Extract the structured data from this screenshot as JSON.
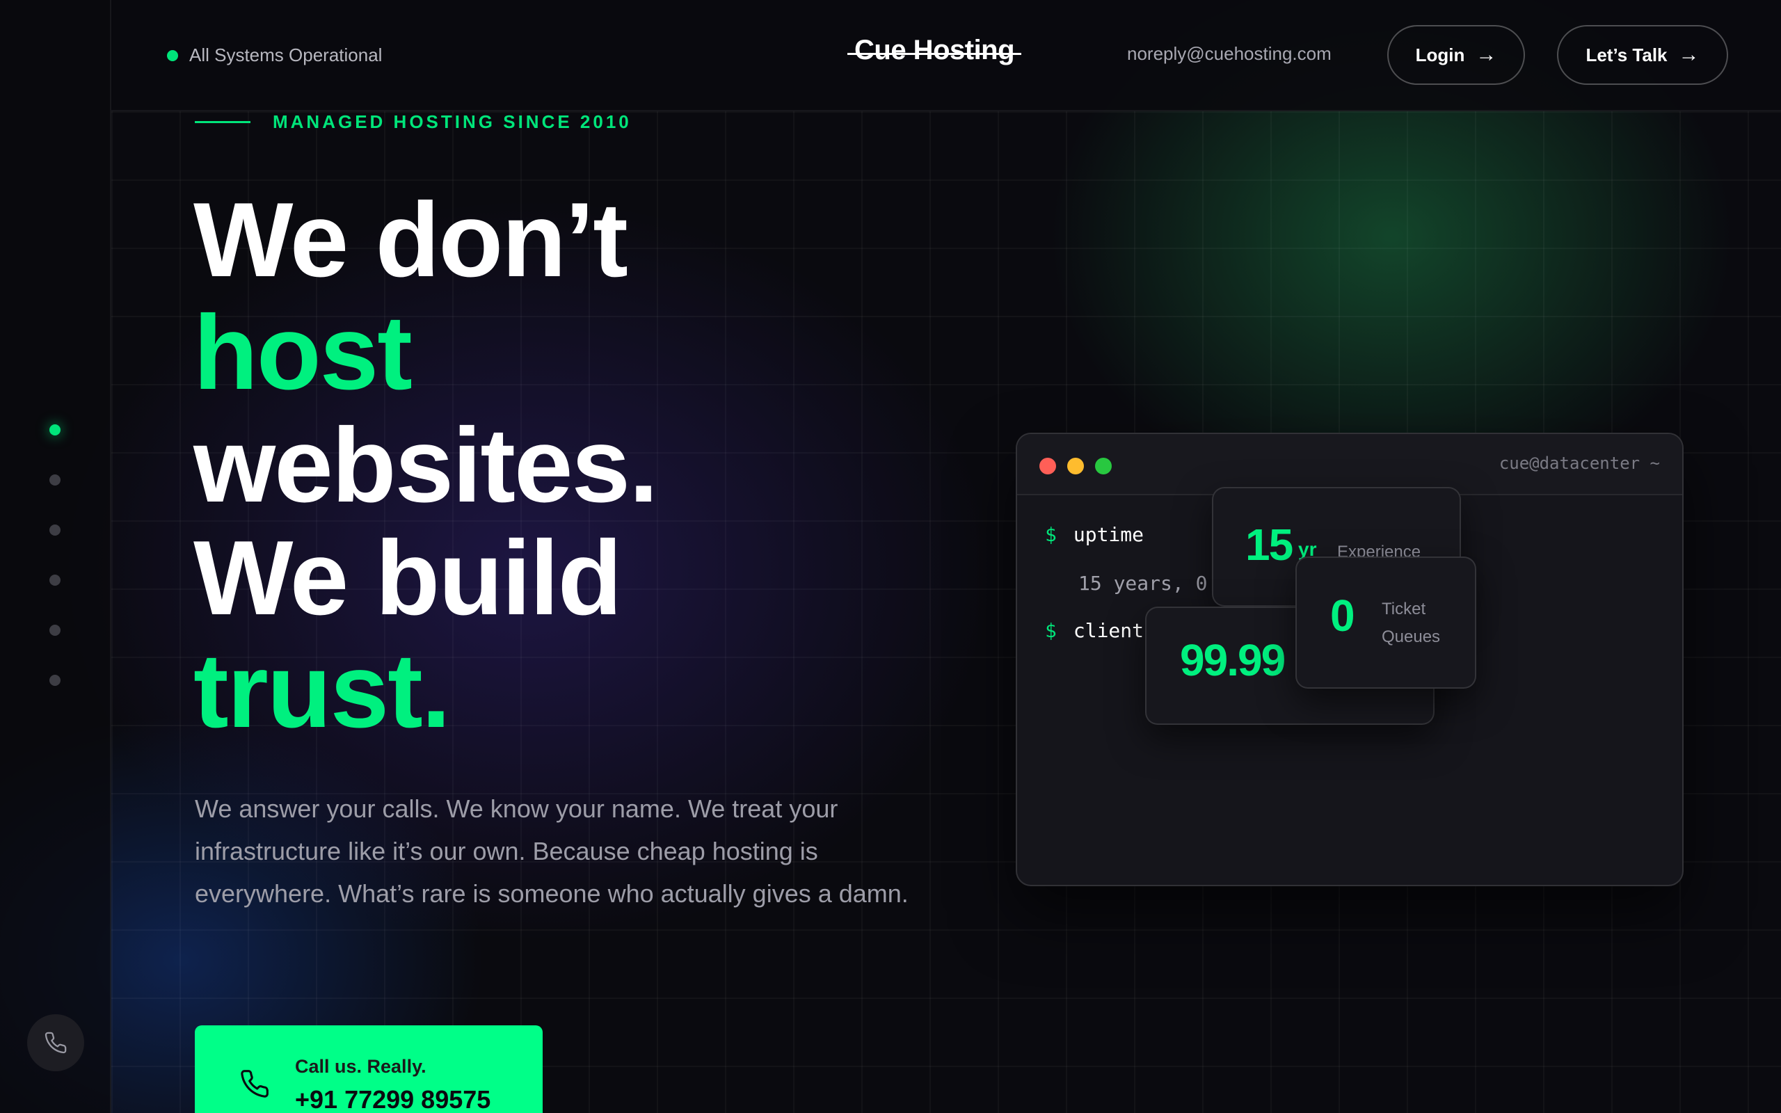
{
  "header": {
    "status_text": "All Systems Operational",
    "logo_text": "Cue Hosting",
    "email": "noreply@cuehosting.com",
    "login_label": "Login",
    "talk_label": "Let’s Talk",
    "arrow": "→"
  },
  "sidebar": {
    "dots_count": 6,
    "active_index": 0
  },
  "hero": {
    "eyebrow": "MANAGED HOSTING SINCE 2010",
    "headline": {
      "line1": "We don’t",
      "line2": "host",
      "line3": "websites.",
      "line4": "We build",
      "line5": "trust."
    },
    "lead": "We answer your calls. We know your name. We treat your infrastructure like it’s our own. Because cheap hosting is everywhere. What’s rare is someone who actually gives a damn.",
    "cta_label": "Call us. Really.",
    "cta_phone": "+91 77299 89575"
  },
  "terminal": {
    "title": "cue@datacenter ~",
    "prompt": "$",
    "cmd1": "uptime",
    "out1": "15 years, 0",
    "cmd2": "client",
    "cards": {
      "experience_value": "15",
      "experience_unit": "yr",
      "experience_label": "Experience",
      "uptime_value": "99.99",
      "tickets_value": "0",
      "tickets_label_1": "Ticket",
      "tickets_label_2": "Queues"
    }
  },
  "colors": {
    "accent": "#00f07f",
    "cta_bg": "#00ff88",
    "background": "#0a0a0f",
    "tl_red": "#ff5f57",
    "tl_yellow": "#febc2e",
    "tl_green": "#28c840"
  },
  "icons": {
    "status": "status-dot-icon",
    "phone": "phone-icon",
    "arrow": "arrow-right-icon"
  }
}
